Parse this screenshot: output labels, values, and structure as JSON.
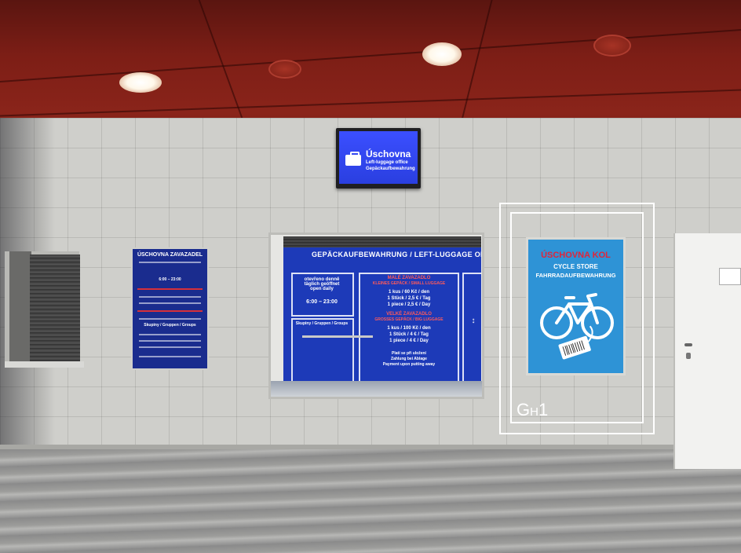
{
  "hanging_sign": {
    "title": "Úschovna",
    "line1": "Left-luggage office",
    "line2": "Gepäckaufbewahrung",
    "icon": "luggage-icon"
  },
  "left_poster": {
    "title": "ÚSCHOVNA ZAVAZADEL",
    "hours": "6:00 – 23:00",
    "section": "Skupiny / Gruppen / Groups"
  },
  "counter": {
    "header": "GEPÄCKAUFBEWAHRUNG / LEFT-LUGGAGE OFFI",
    "hours_label": "otevřeno denně\ntäglich geöffnet\nopen daily",
    "hours": "6:00 – 23:00",
    "small_title": "MALÉ ZAVAZADLO",
    "small_title2": "KLEINES GEPÄCK / SMALL LUGGAGE",
    "small_prices": [
      "1 kus / 60 Kč / den",
      "1 Stück / 2,5 € / Tag",
      "1 piece / 2,5 € / Day"
    ],
    "big_title": "VELKÉ ZAVAZADLO",
    "big_title2": "GROSSES GEPÄCK / BIG LUGGAGE",
    "big_prices": [
      "1 kus / 100 Kč / den",
      "1 Stück / 4 € / Tag",
      "1 piece / 4 € / Day"
    ],
    "payment": [
      "Platí se při uložení",
      "Zahlung bei Ablage",
      "Payment upon putting away"
    ],
    "groups": "Skupiny / Gruppen / Groups"
  },
  "bike_poster": {
    "title": "ÚSCHOVNA KOL",
    "line1": "CYCLE STORE",
    "line2": "FAHRRADAUFBEWAHRUNG",
    "icon": "bicycle-icon"
  },
  "annotation": {
    "label_main": "G",
    "label_sub": "H",
    "label_num": "1",
    "color": "#ffffff"
  }
}
